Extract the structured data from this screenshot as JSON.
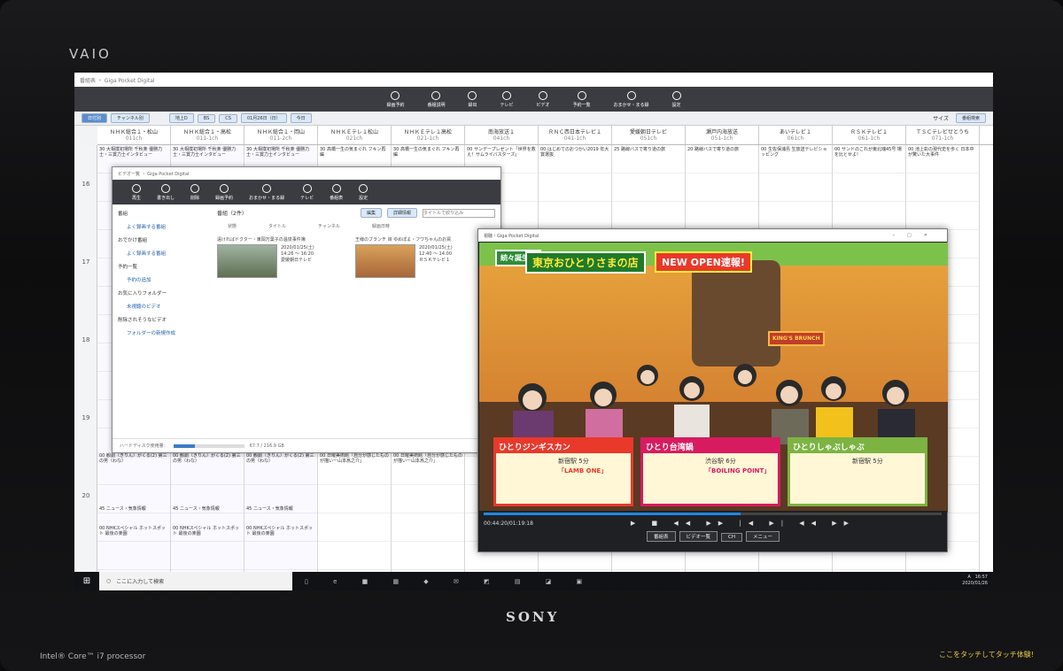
{
  "bezel": {
    "top_brand": "VAIO",
    "bottom_brand": "SONY",
    "processor": "Intel® Core™ i7 processor",
    "touch_hint": "ここをタッチしてタッチ体験!"
  },
  "epg": {
    "title": "番組表 ・ Giga Pocket Digital",
    "toolbar": [
      "録画予約",
      "番組説明",
      "録出",
      "テレビ",
      "ビデオ",
      "予約一覧",
      "おまかせ・まる録",
      "設定"
    ],
    "tabs": [
      "日付別",
      "チャンネル別"
    ],
    "filters": [
      "地上D",
      "BS",
      "CS"
    ],
    "date": "01月26日（日）",
    "today": "今日",
    "size_label": "サイズ",
    "search_button": "番組検索",
    "channels": [
      {
        "name": "ＮＨＫ総合１・松山",
        "ch": "011ch"
      },
      {
        "name": "ＮＨＫ総合１・高松",
        "ch": "011-1ch"
      },
      {
        "name": "ＮＨＫ総合１・岡山",
        "ch": "011-2ch"
      },
      {
        "name": "ＮＨＫＥテレ１松山",
        "ch": "021ch"
      },
      {
        "name": "ＮＨＫＥテレ１高松",
        "ch": "021-1ch"
      },
      {
        "name": "南海放送１",
        "ch": "041ch"
      },
      {
        "name": "ＲＮＣ西日本テレビ１",
        "ch": "041-1ch"
      },
      {
        "name": "愛媛朝日テレビ",
        "ch": "051ch"
      },
      {
        "name": "瀬戸内海放送",
        "ch": "051-1ch"
      },
      {
        "name": "あいテレビ１",
        "ch": "061ch"
      },
      {
        "name": "ＲＳＫテレビ１",
        "ch": "061-1ch"
      },
      {
        "name": "ＴＳＣテレビせとうち",
        "ch": "071-1ch"
      }
    ],
    "hours": [
      "16",
      "17",
      "18",
      "19",
      "20"
    ],
    "cells": [
      "30 大相撲初場所 千秋楽 優勝力士・三賞力士インタビュー",
      "30 大相撲初場所 千秋楽 優勝力士・三賞力士インタビュー",
      "30 大相撲初場所 千秋楽 優勝力士・三賞力士インタビュー",
      "30 高橋一生の気まぐれ フキン再編",
      "30 高橋一生の気まぐれ フキン再編",
      "00 サンデープレゼント「世界を救え！サムライバスターズ」",
      "00 はじめてのおつかい2019 年大賞選抜",
      "25 路線バスで寄り道の旅",
      "20 路線バスで寄り道の旅",
      "00 生佐保浦島 生放送テレビショッピング",
      "00 サンドのこれが東北魂45号 場を比とせよ!",
      "00 池上彰の現代史を歩く 日本中が驚いた大事件"
    ],
    "evening": [
      "00 観劇（きりん）がくる(2) 第三の男（わな）",
      "00 観劇（きりん）がくる(2) 第三の男（わな）",
      "00 観劇（きりん）がくる(2) 第三の男（わな）",
      "00 日曜美術館「自分が感じたものが描いー山本爲之介」",
      "00 日曜美術館「自分が感じたものが描いー山本爲之介」"
    ],
    "news": "45 ニュース・気象情報",
    "special": "00 NHKスペシャル ホットスポット 最後の楽園"
  },
  "video_window": {
    "title": "ビデオ一覧 ・ Giga Pocket Digital",
    "toolbar": [
      "再生",
      "書き出し",
      "削除",
      "録画予約",
      "おまかせ・まる録",
      "テレビ",
      "番組表",
      "設定"
    ],
    "sidebar": [
      "番組",
      "よく録画する番組",
      "おでかけ番組",
      "よく録画する番組",
      "予約一覧",
      "予約の追加",
      "お気に入りフォルダー",
      "未視聴のビデオ",
      "削除されそうなビデオ",
      "フォルダーの新規作成"
    ],
    "heading": "番組（2件）",
    "edit": "編集",
    "detail": "詳細情報",
    "search_placeholder": "タイトルで絞り込み",
    "columns": [
      "状態",
      "タイトル",
      "チャンネル",
      "録画日時"
    ],
    "items": [
      {
        "title": "遠ければドクター・東岡万葉子の温泉事件簿",
        "date": "2020/01/25(土)",
        "time": "14:26 ～ 16:20",
        "channel": "愛媛朝日テレビ"
      },
      {
        "title": "王様のブランチ 目 ゆめぽよ・フワちゃんのお買",
        "date": "2020/01/25(土)",
        "time": "12:40 ～ 14:00",
        "channel": "ＲＳＫテレビ１"
      }
    ],
    "disk_label": "ハードディスク使用量：",
    "disk_value": "67.7 / 216.9 GB",
    "disk_fraction": 0.31
  },
  "player": {
    "title": "視聴・Giga Pocket Digital",
    "banner": "東京おひとりさまの店",
    "badge": "NEW OPEN速報!",
    "corner": "続々誕生！",
    "show_logo": "KING'S BRUNCH",
    "cards": [
      {
        "title": "ひとりジンギスカン",
        "station": "新宿駅",
        "minutes": "5分",
        "shop": "「LAMB ONE」"
      },
      {
        "title": "ひとり台湾鍋",
        "station": "渋谷駅",
        "minutes": "6分",
        "shop": "「BOILING POINT」"
      },
      {
        "title": "ひとりしゃぶしゃぶ",
        "station": "新宿駅",
        "minutes": "5分",
        "shop": ""
      }
    ],
    "time": "00:44:20/01:19:18",
    "progress_fraction": 0.56,
    "buttons": [
      "番組表",
      "ビデオ一覧",
      "CH",
      "メニュー"
    ]
  },
  "taskbar": {
    "search": "ここに入力して検索",
    "time": "16:57",
    "date": "2020/01/26",
    "ime": "A"
  }
}
